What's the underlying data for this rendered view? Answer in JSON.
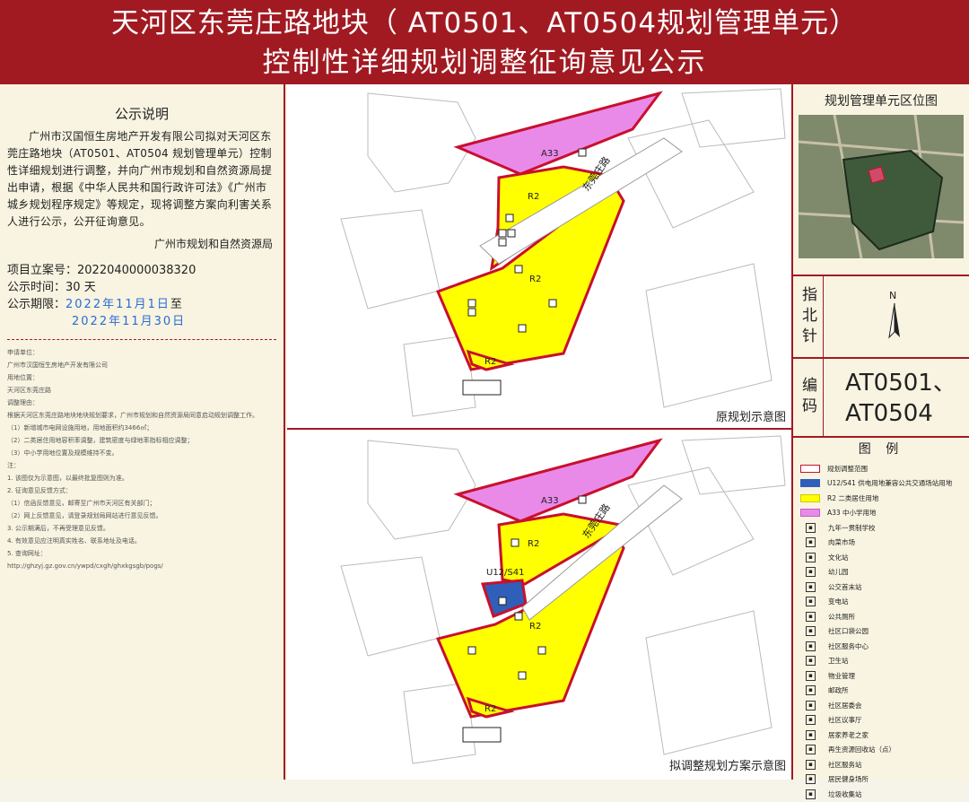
{
  "header": {
    "line1": "天河区东莞庄路地块（ AT0501、AT0504规划管理单元）",
    "line2": "控制性详细规划调整征询意见公示"
  },
  "notice": {
    "title": "公示说明",
    "body": "广州市汉国恒生房地产开发有限公司拟对天河区东莞庄路地块（AT0501、AT0504 规划管理单元）控制性详细规划进行调整，并向广州市规划和自然资源局提出申请，根据《中华人民共和国行政许可法》《广州市城乡规划程序规定》等规定，现将调整方案向利害关系人进行公示，公开征询意见。",
    "signature": "广州市规划和自然资源局",
    "project_label": "项目立案号：",
    "project_no": "2022040000038320",
    "duration_label": "公示时间：",
    "duration": "30 天",
    "period_label": "公示期限：",
    "period_start": "2022年11月1日",
    "period_mid": "至",
    "period_end": "2022年11月30日"
  },
  "fine_print": {
    "lines": [
      "申请单位：",
      "广州市汉国恒生房地产开发有限公司",
      "用地位置：",
      "天河区东莞庄路",
      "调整理由：",
      "根据天河区东莞庄路地块地块规划要求，广州市规划和自然资源局同意启动规划调整工作。",
      "（1）新增城市电网设施用地，用地面积约3466㎡；",
      "（2）二类居住用地容积率调整，建筑密度与绿地率指标相应调整；",
      "（3）中小学用地位置及规模维持不变。",
      "注：",
      "1. 该图仅为示意图，以最终批复图则为准。",
      "2. 征询意见反馈方式：",
      "（1）信函反馈意见，邮寄至广州市天河区有关部门；",
      "（2）网上反馈意见，请登录规划局网站进行意见反馈。",
      "3. 公示期满后，不再受理意见反馈。",
      "4. 有效意见应注明真实姓名、联系地址及电话。",
      "5. 查询网址：",
      "http://ghzyj.gz.gov.cn/ywpd/cxgh/ghxkgsgb/pogs/"
    ]
  },
  "maps": {
    "original_label": "原规划示意图",
    "adjusted_label": "拟调整规划方案示意图",
    "road_label": "东莞庄路",
    "zone_labels": [
      "A33",
      "R2",
      "R2",
      "R2"
    ],
    "utility_label": "U12/S41"
  },
  "location_panel": {
    "title": "规划管理单元区位图"
  },
  "north": {
    "label": "指北针",
    "letter": "N"
  },
  "codes": {
    "label": "编码",
    "line1": "AT0501、",
    "line2": "AT0504"
  },
  "legend": {
    "title": "图 例",
    "swatches": [
      {
        "label": "规划调整范围",
        "color": "#ffffff",
        "border": "#c8102e"
      },
      {
        "label": "U12/S41 供电用地兼容公共交通场站用地",
        "color": "#2f5fb8",
        "border": "#2f5fb8"
      },
      {
        "label": "R2 二类居住用地",
        "color": "#ffff00",
        "border": "#cccc00"
      },
      {
        "label": "A33 中小学用地",
        "color": "#e98ae9",
        "border": "#c060c0"
      }
    ],
    "icons": [
      "九年一贯制学校",
      "肉菜市场",
      "文化站",
      "幼儿园",
      "公交首末站",
      "变电站",
      "公共厕所",
      "社区口袋公园",
      "社区服务中心",
      "卫生站",
      "物业管理",
      "邮政所",
      "社区居委会",
      "社区议事厅",
      "居家养老之家",
      "再生资源回收站（点）",
      "社区服务站",
      "居民健身场所",
      "垃圾收集站"
    ],
    "colors": {
      "boundary": "#c8102e",
      "r2": "#ffff00",
      "a33": "#e98ae9",
      "u12": "#2f5fb8",
      "header_bg": "#a11a22"
    }
  }
}
